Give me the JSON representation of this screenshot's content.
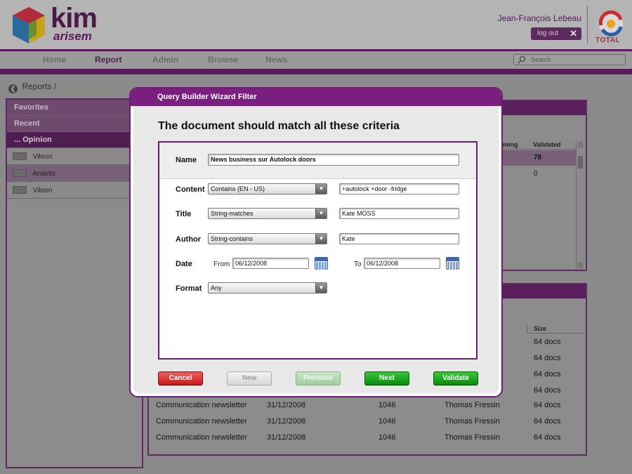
{
  "brand": {
    "product_top": "kim",
    "product_bottom": "arisem",
    "partner": "TOTAL"
  },
  "header": {
    "user_name": "Jean-François Lebeau",
    "logout_label": "log out"
  },
  "nav": {
    "items": [
      "Home",
      "Report",
      "Admin",
      "Browse",
      "News"
    ],
    "active": "Report",
    "search_placeholder": "Search"
  },
  "breadcrumb": "Reports /",
  "sidebar": {
    "tabs": [
      "Favorites",
      "Recent",
      "... Opinion"
    ],
    "items": [
      {
        "label": "Vileon"
      },
      {
        "label": "Anaxtis",
        "selected": true
      },
      {
        "label": "Vileon"
      }
    ]
  },
  "top_table": {
    "headers": [
      "ming",
      "Validated"
    ],
    "rows": [
      [
        "",
        "78"
      ],
      [
        "",
        "0"
      ]
    ]
  },
  "bottom_table": {
    "size_header": "Size",
    "partial_sizes": [
      "64 docs",
      "64 docs",
      "64 docs",
      "64 docs"
    ],
    "rows": [
      [
        "Communication newsletter",
        "31/12/2008",
        "1046",
        "Thomas Fressin",
        "64 docs"
      ],
      [
        "Communication newsletter",
        "31/12/2008",
        "1046",
        "Thomas Fressin",
        "64 docs"
      ],
      [
        "Communication newsletter",
        "31/12/2008",
        "1046",
        "Thomas Fressin",
        "64 docs"
      ]
    ]
  },
  "modal": {
    "title": "Query Builder Wizard Filter",
    "heading": "The document should match all these criteria",
    "name_label": "Name",
    "name_value": "News business sur Autolock doors",
    "criteria": {
      "content": {
        "label": "Content",
        "operator": "Contains (EN - US)",
        "value": "+autolock +door -fridge"
      },
      "title": {
        "label": "Title",
        "operator": "String-matches",
        "value": "Kate MOSS"
      },
      "author": {
        "label": "Author",
        "operator": "String-contains",
        "value": "Kate"
      },
      "date": {
        "label": "Date",
        "from_label": "From",
        "from_value": "06/12/2008",
        "to_label": "To",
        "to_value": "06/12/2008"
      },
      "format": {
        "label": "Format",
        "operator": "Any"
      }
    },
    "buttons": {
      "cancel": "Cancel",
      "new": "New",
      "previous": "Previous",
      "next": "Next",
      "validate": "Validate"
    }
  }
}
